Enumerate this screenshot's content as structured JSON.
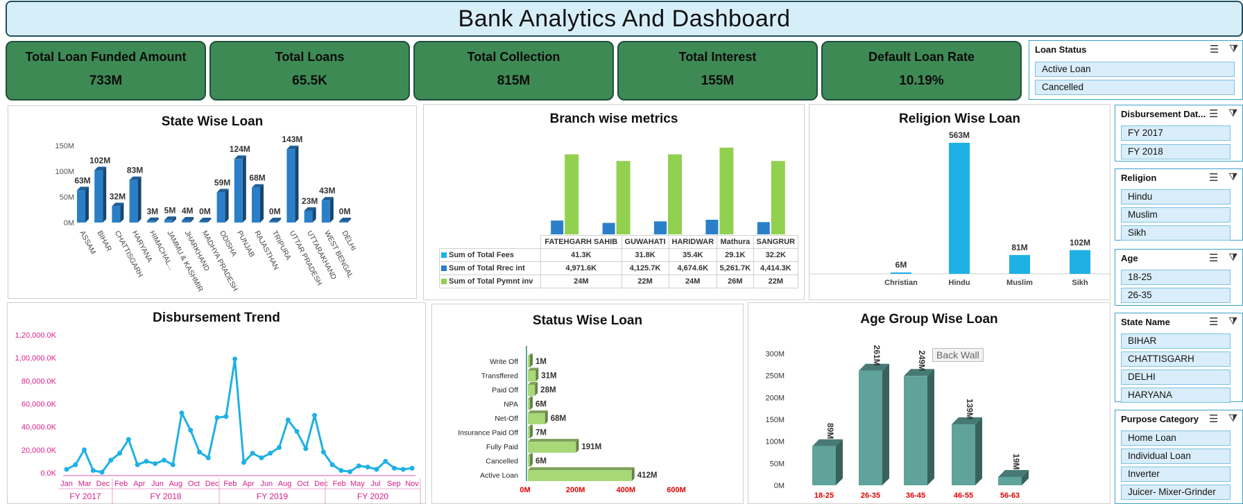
{
  "title": "Bank Analytics And Dashboard",
  "kpis": [
    {
      "label": "Total Loan Funded Amount",
      "value": "733M"
    },
    {
      "label": "Total Loans",
      "value": "65.5K"
    },
    {
      "label": "Total Collection",
      "value": "815M"
    },
    {
      "label": "Total Interest",
      "value": "155M"
    },
    {
      "label": "Default Loan Rate",
      "value": "10.19%"
    }
  ],
  "slicers": {
    "loan_status": {
      "title": "Loan Status",
      "items": [
        "Active Loan",
        "Cancelled"
      ]
    },
    "disbursement": {
      "title": "Disbursement Dat...",
      "items": [
        "FY 2017",
        "FY 2018"
      ]
    },
    "religion": {
      "title": "Religion",
      "items": [
        "Hindu",
        "Muslim",
        "Sikh"
      ]
    },
    "age": {
      "title": "Age",
      "items": [
        "18-25",
        "26-35"
      ]
    },
    "state": {
      "title": "State Name",
      "items": [
        "BIHAR",
        "CHATTISGARH",
        "DELHI",
        "HARYANA"
      ]
    },
    "purpose": {
      "title": "Purpose Category",
      "items": [
        "Home Loan",
        "Individual Loan",
        "Inverter",
        "Juicer- Mixer-Grinder"
      ]
    }
  },
  "tooltip": "Back Wall",
  "chart_data": [
    {
      "type": "bar",
      "title": "State Wise Loan",
      "categories": [
        "ASSAM",
        "BIHAR",
        "CHATTISGARH",
        "HARYANA",
        "HIMACHAL...",
        "JAMMU & KASHMIR",
        "JHARKHAND",
        "MADHYA PRADESH",
        "ODISHA",
        "PUNJAB",
        "RAJASTHAN",
        "TRIPURA",
        "UTTAR PRADESH",
        "UTTARAKHAND",
        "WEST BENGAL",
        "DELHI"
      ],
      "values": [
        63,
        102,
        32,
        83,
        3,
        5,
        4,
        0,
        59,
        124,
        68,
        0,
        143,
        23,
        43,
        0
      ],
      "data_labels": [
        "63M",
        "102M",
        "32M",
        "83M",
        "3M",
        "5M",
        "4M",
        "0M",
        "59M",
        "124M",
        "68M",
        "0M",
        "143M",
        "23M",
        "43M",
        "0M"
      ],
      "yticks": [
        "0M",
        "50M",
        "100M",
        "150M"
      ],
      "ylim": [
        0,
        150
      ],
      "color": "#2a7fc8"
    },
    {
      "type": "bar",
      "title": "Branch wise metrics",
      "categories": [
        "FATEHGARH SAHIB",
        "GUWAHATI",
        "HARIDWAR",
        "Mathura",
        "SANGRUR"
      ],
      "series": [
        {
          "name": "Sum of Total Fees",
          "values": [
            "41.3K",
            "31.8K",
            "35.4K",
            "29.1K",
            "32.2K"
          ],
          "color": "#1fb0e6"
        },
        {
          "name": "Sum of Total Rrec int",
          "values": [
            "4,971.6K",
            "4,125.7K",
            "4,674.6K",
            "5,261.7K",
            "4,414.3K"
          ],
          "numeric": [
            4971.6,
            4125.7,
            4674.6,
            5261.7,
            4414.3
          ],
          "color": "#2a7fc8"
        },
        {
          "name": "Sum of Total Pymnt inv",
          "values": [
            "24M",
            "22M",
            "24M",
            "26M",
            "22M"
          ],
          "numeric": [
            24,
            22,
            24,
            26,
            22
          ],
          "color": "#92d050"
        }
      ]
    },
    {
      "type": "bar",
      "title": "Religion Wise Loan",
      "categories": [
        "Christian",
        "Hindu",
        "Muslim",
        "Sikh"
      ],
      "values": [
        6,
        563,
        81,
        102
      ],
      "data_labels": [
        "6M",
        "563M",
        "81M",
        "102M"
      ],
      "color": "#1fb0e6"
    },
    {
      "type": "line",
      "title": "Disbursement Trend",
      "x": [
        "Jan",
        "Mar",
        "Dec",
        "Feb",
        "Apr",
        "Jun",
        "Aug",
        "Oct",
        "Dec",
        "Feb",
        "Apr",
        "Jun",
        "Aug",
        "Oct",
        "Dec",
        "Feb",
        "May",
        "Jul",
        "Sep",
        "Nov"
      ],
      "x_groups": [
        "FY 2017",
        "FY 2018",
        "FY 2019",
        "FY 2020"
      ],
      "values": [
        3000,
        7000,
        20000,
        2000,
        500,
        11000,
        17000,
        29000,
        7000,
        10000,
        8000,
        11000,
        7000,
        52000,
        37000,
        18000,
        13000,
        48000,
        49000,
        99000,
        9000,
        17000,
        13000,
        17000,
        22000,
        46000,
        36000,
        21000,
        50000,
        18000,
        7000,
        2000,
        1000,
        6000,
        5000,
        3000,
        10000,
        4000,
        3000,
        4000
      ],
      "yticks": [
        "0.0K",
        "20,000.0K",
        "40,000.0K",
        "60,000.0K",
        "80,000.0K",
        "1,00,000.0K",
        "1,20,000.0K"
      ],
      "ylim": [
        0,
        120000
      ],
      "color": "#1fb0e6"
    },
    {
      "type": "bar",
      "title": "Status Wise Loan",
      "categories": [
        "Write Off",
        "Transffered",
        "Paid Off",
        "NPA",
        "Net-Off",
        "Insurance Paid Off",
        "Fully Paid",
        "Cancelled",
        "Active Loan"
      ],
      "values": [
        1,
        31,
        28,
        6,
        68,
        7,
        191,
        6,
        412
      ],
      "data_labels": [
        "1M",
        "31M",
        "28M",
        "6M",
        "68M",
        "7M",
        "191M",
        "6M",
        "412M"
      ],
      "xticks": [
        "0M",
        "200M",
        "400M",
        "600M"
      ],
      "xlim": [
        0,
        600
      ],
      "color": "#a9d879"
    },
    {
      "type": "bar",
      "title": "Age Group Wise Loan",
      "categories": [
        "18-25",
        "26-35",
        "36-45",
        "46-55",
        "56-63"
      ],
      "values": [
        89,
        261,
        249,
        139,
        19
      ],
      "data_labels": [
        "89M",
        "261M",
        "249M",
        "139M",
        "19M"
      ],
      "yticks": [
        "0M",
        "50M",
        "100M",
        "150M",
        "200M",
        "250M",
        "300M"
      ],
      "ylim": [
        0,
        300
      ],
      "color": "#5fa39a"
    }
  ]
}
